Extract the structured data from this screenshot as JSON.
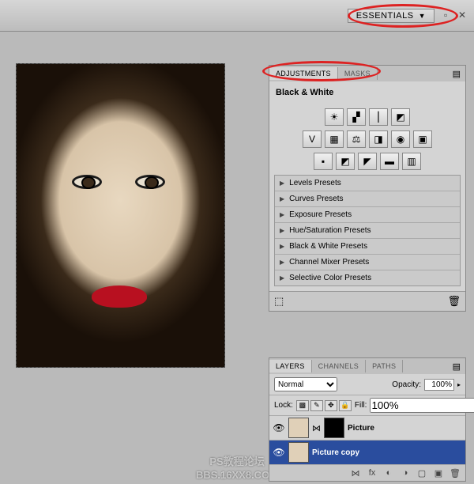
{
  "topbar": {
    "workspace": "ESSENTIALS"
  },
  "adjustments": {
    "tabs": {
      "a": "ADJUSTMENTS",
      "b": "MASKS"
    },
    "title": "Black & White",
    "presets": [
      "Levels Presets",
      "Curves Presets",
      "Exposure Presets",
      "Hue/Saturation Presets",
      "Black & White Presets",
      "Channel Mixer Presets",
      "Selective Color Presets"
    ]
  },
  "layers_panel": {
    "tabs": {
      "a": "LAYERS",
      "b": "CHANNELS",
      "c": "PATHS"
    },
    "blend": "Normal",
    "opacity_label": "Opacity:",
    "opacity_value": "100%",
    "lock_label": "Lock:",
    "fill_label": "Fill:",
    "fill_value": "100%",
    "layers": [
      {
        "name": "Picture",
        "selected": false,
        "has_mask": true
      },
      {
        "name": "Picture copy",
        "selected": true,
        "has_mask": false
      }
    ]
  },
  "watermark": {
    "line1": "PS教程论坛",
    "line2": "BBS.16XX8.COM"
  }
}
